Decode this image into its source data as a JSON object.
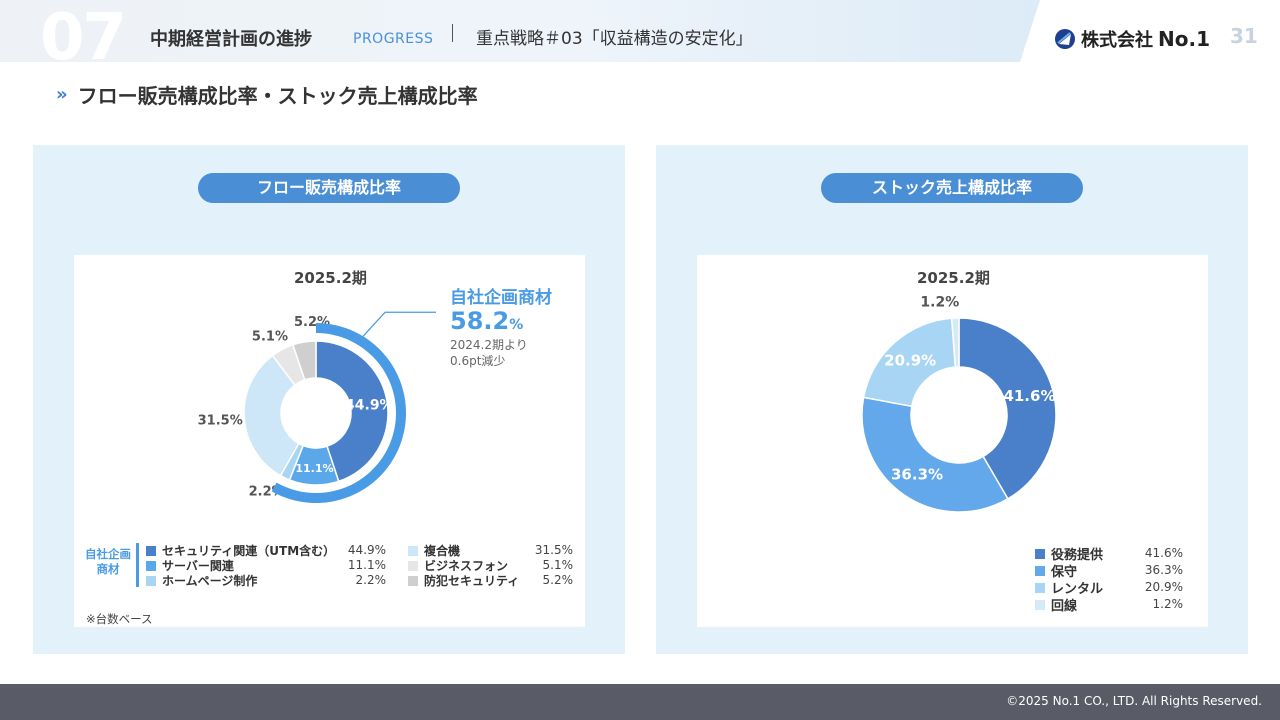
{
  "header": {
    "chapter": "07",
    "title": "中期経営計画の進捗",
    "progress_label": "PROGRESS",
    "strategy": "重点戦略＃03「収益構造の安定化」",
    "company": "株式会社",
    "brand": "No.1",
    "page_number": "31",
    "brand_color": "#1f3f8f"
  },
  "section_title": "フロー販売構成比率・ストック売上構成比率",
  "left_panel": {
    "pill": "フロー販売構成比率",
    "period": "2025.2期",
    "callout": {
      "title": "自社企画商材",
      "value": "58.2",
      "unit": "%",
      "note_line1": "2024.2期より",
      "note_line2": "0.6pt減少"
    },
    "group_label_line1": "自社企画",
    "group_label_line2": "商材",
    "footnote": "※台数ベース",
    "legend": [
      {
        "label": "セキュリティ関連（UTM含む）",
        "value": "44.9%"
      },
      {
        "label": "サーバー関連",
        "value": "11.1%"
      },
      {
        "label": "ホームページ制作",
        "value": "2.2%"
      },
      {
        "label": "複合機",
        "value": "31.5%"
      },
      {
        "label": "ビジネスフォン",
        "value": "5.1%"
      },
      {
        "label": "防犯セキュリティ",
        "value": "5.2%"
      }
    ]
  },
  "right_panel": {
    "pill": "ストック売上構成比率",
    "period": "2025.2期",
    "legend": [
      {
        "label": "役務提供",
        "value": "41.6%"
      },
      {
        "label": "保守",
        "value": "36.3%"
      },
      {
        "label": "レンタル",
        "value": "20.9%"
      },
      {
        "label": "回線",
        "value": "1.2%"
      }
    ]
  },
  "chart_data": [
    {
      "type": "pie",
      "variant": "donut",
      "title": "2025.2期",
      "categories": [
        "セキュリティ関連（UTM含む）",
        "サーバー関連",
        "ホームページ制作",
        "複合機",
        "ビジネスフォン",
        "防犯セキュリティ"
      ],
      "values": [
        44.9,
        11.1,
        2.2,
        31.5,
        5.1,
        5.2
      ],
      "labels": [
        "44.9%",
        "11.1%",
        "2.2%",
        "31.5%",
        "5.1%",
        "5.2%"
      ],
      "colors": [
        "#4a7fc9",
        "#5aa8ea",
        "#a9d5f5",
        "#cde6f8",
        "#e6e6e6",
        "#cfcfcf"
      ],
      "highlight": {
        "label": "自社企画商材",
        "value": 58.2,
        "series_indices": [
          0,
          1,
          2
        ],
        "color": "#4a9be5"
      }
    },
    {
      "type": "pie",
      "variant": "donut",
      "title": "2025.2期",
      "categories": [
        "役務提供",
        "保守",
        "レンタル",
        "回線"
      ],
      "values": [
        41.6,
        36.3,
        20.9,
        1.2
      ],
      "labels": [
        "41.6%",
        "36.3%",
        "20.9%",
        "1.2%"
      ],
      "colors": [
        "#4a7fc9",
        "#62a8ea",
        "#a9d5f5",
        "#d5eaf9"
      ]
    }
  ],
  "footer": {
    "copyright": "©2025 No.1 CO., LTD. All Rights Reserved."
  }
}
